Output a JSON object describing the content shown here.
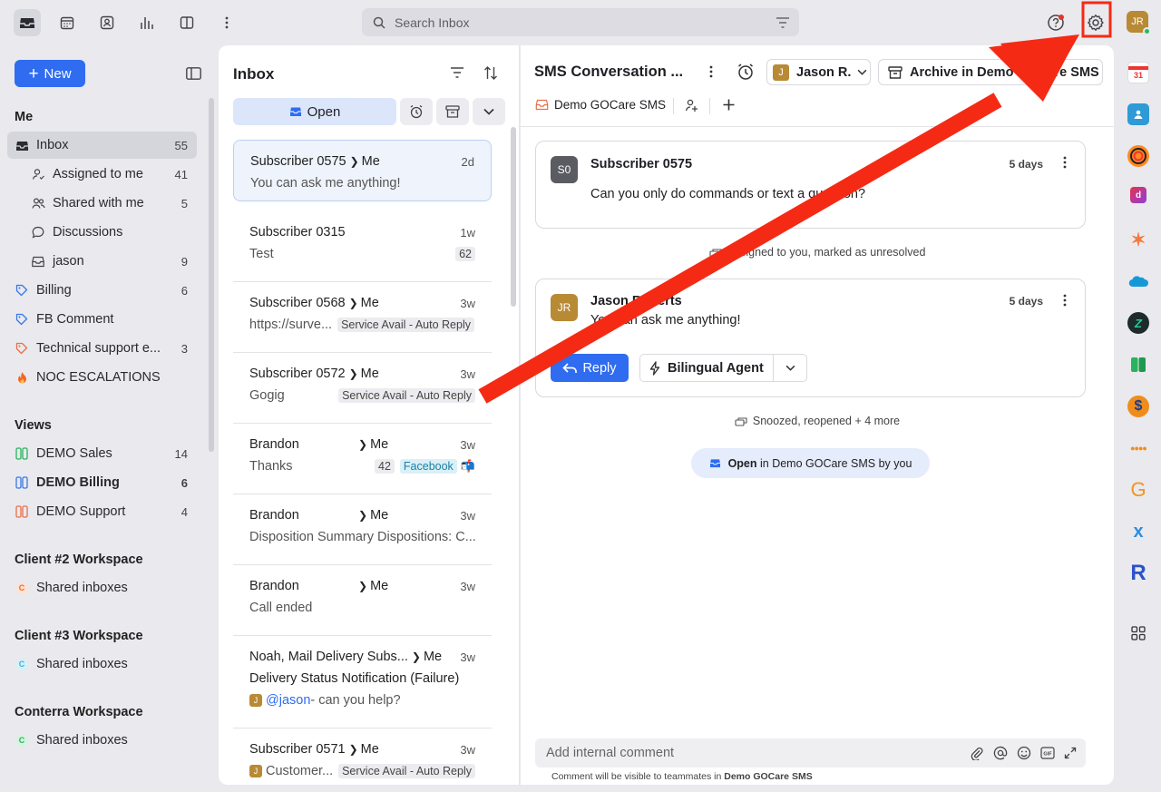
{
  "topbar": {
    "search_placeholder": "Search Inbox",
    "avatar_initials": "JR"
  },
  "sidebar": {
    "new_label": "New",
    "me_heading": "Me",
    "items": [
      {
        "label": "Inbox",
        "count": "55"
      },
      {
        "label": "Assigned to me",
        "count": "41"
      },
      {
        "label": "Shared with me",
        "count": "5"
      },
      {
        "label": "Discussions",
        "count": ""
      },
      {
        "label": "jason",
        "count": "9"
      },
      {
        "label": "Billing",
        "count": "6"
      },
      {
        "label": "FB Comment",
        "count": ""
      },
      {
        "label": "Technical support e...",
        "count": "3"
      },
      {
        "label": "NOC ESCALATIONS",
        "count": ""
      }
    ],
    "views_heading": "Views",
    "views": [
      {
        "label": "DEMO Sales",
        "count": "14"
      },
      {
        "label": "DEMO Billing",
        "count": "6"
      },
      {
        "label": "DEMO Support",
        "count": "4"
      }
    ],
    "workspaces": [
      {
        "title": "Client #2 Workspace",
        "item": "Shared inboxes",
        "badge": "C",
        "color": "#f06a2a"
      },
      {
        "title": "Client #3 Workspace",
        "item": "Shared inboxes",
        "badge": "C",
        "color": "#39b6d6"
      },
      {
        "title": "Conterra Workspace",
        "item": "Shared inboxes",
        "badge": "C",
        "color": "#2ab35e"
      }
    ]
  },
  "list": {
    "title": "Inbox",
    "open_label": "Open",
    "conversations": [
      {
        "from": "Subscriber 0575",
        "to": "Me",
        "time": "2d",
        "preview": "You can ask me anything!"
      },
      {
        "from": "Subscriber 0315",
        "to": "",
        "time": "1w",
        "preview": "Test",
        "count": "62"
      },
      {
        "from": "Subscriber 0568",
        "to": "Me",
        "time": "3w",
        "preview": "https://surve...",
        "tag": "Service Avail - Auto Reply"
      },
      {
        "from": "Subscriber 0572",
        "to": "Me",
        "time": "3w",
        "preview": "Gogig",
        "tag": "Service Avail - Auto Reply"
      },
      {
        "from": "Brandon",
        "to": "Me",
        "time": "3w",
        "preview": "Thanks",
        "count": "42",
        "tag": "Facebook"
      },
      {
        "from": "Brandon",
        "to": "Me",
        "time": "3w",
        "preview": "Disposition Summary Dispositions: C..."
      },
      {
        "from": "Brandon",
        "to": "Me",
        "time": "3w",
        "preview": "Call ended"
      },
      {
        "from": "Noah, Mail Delivery Subs...",
        "to": "Me",
        "time": "3w",
        "preview": "Delivery Status Notification (Failure)",
        "mention": "@jason",
        "mention_rest": " - can you help?",
        "avatar": "J"
      },
      {
        "from": "Subscriber 0571",
        "to": "Me",
        "time": "3w",
        "preview": "Customer...",
        "tag": "Service Avail - Auto Reply",
        "avatar": "J"
      }
    ]
  },
  "conversation": {
    "title": "SMS Conversation ...",
    "assignee": "Jason R.",
    "assignee_initial": "J",
    "archive_label": "Archive in Demo GOCare SMS",
    "channel": "Demo GOCare SMS",
    "messages": [
      {
        "initials": "S0",
        "author": "Subscriber 0575",
        "time": "5 days",
        "body": "Can you only do commands or text a question?"
      },
      {
        "initials": "JR",
        "author": "Jason Roberts",
        "time": "5 days",
        "body": "You can ask me anything!"
      }
    ],
    "event1": "Assigned to you, marked as unresolved",
    "event2": "Snoozed, reopened + 4 more",
    "status_bold": "Open",
    "status_rest": " in Demo GOCare SMS by you",
    "reply_label": "Reply",
    "agent_label": "Bilingual Agent",
    "comment_placeholder": "Add internal comment",
    "comment_note": "Comment will be visible to teammates in ",
    "comment_note_bold": "Demo GOCare SMS"
  },
  "annotation": {
    "color": "#f52a14"
  }
}
